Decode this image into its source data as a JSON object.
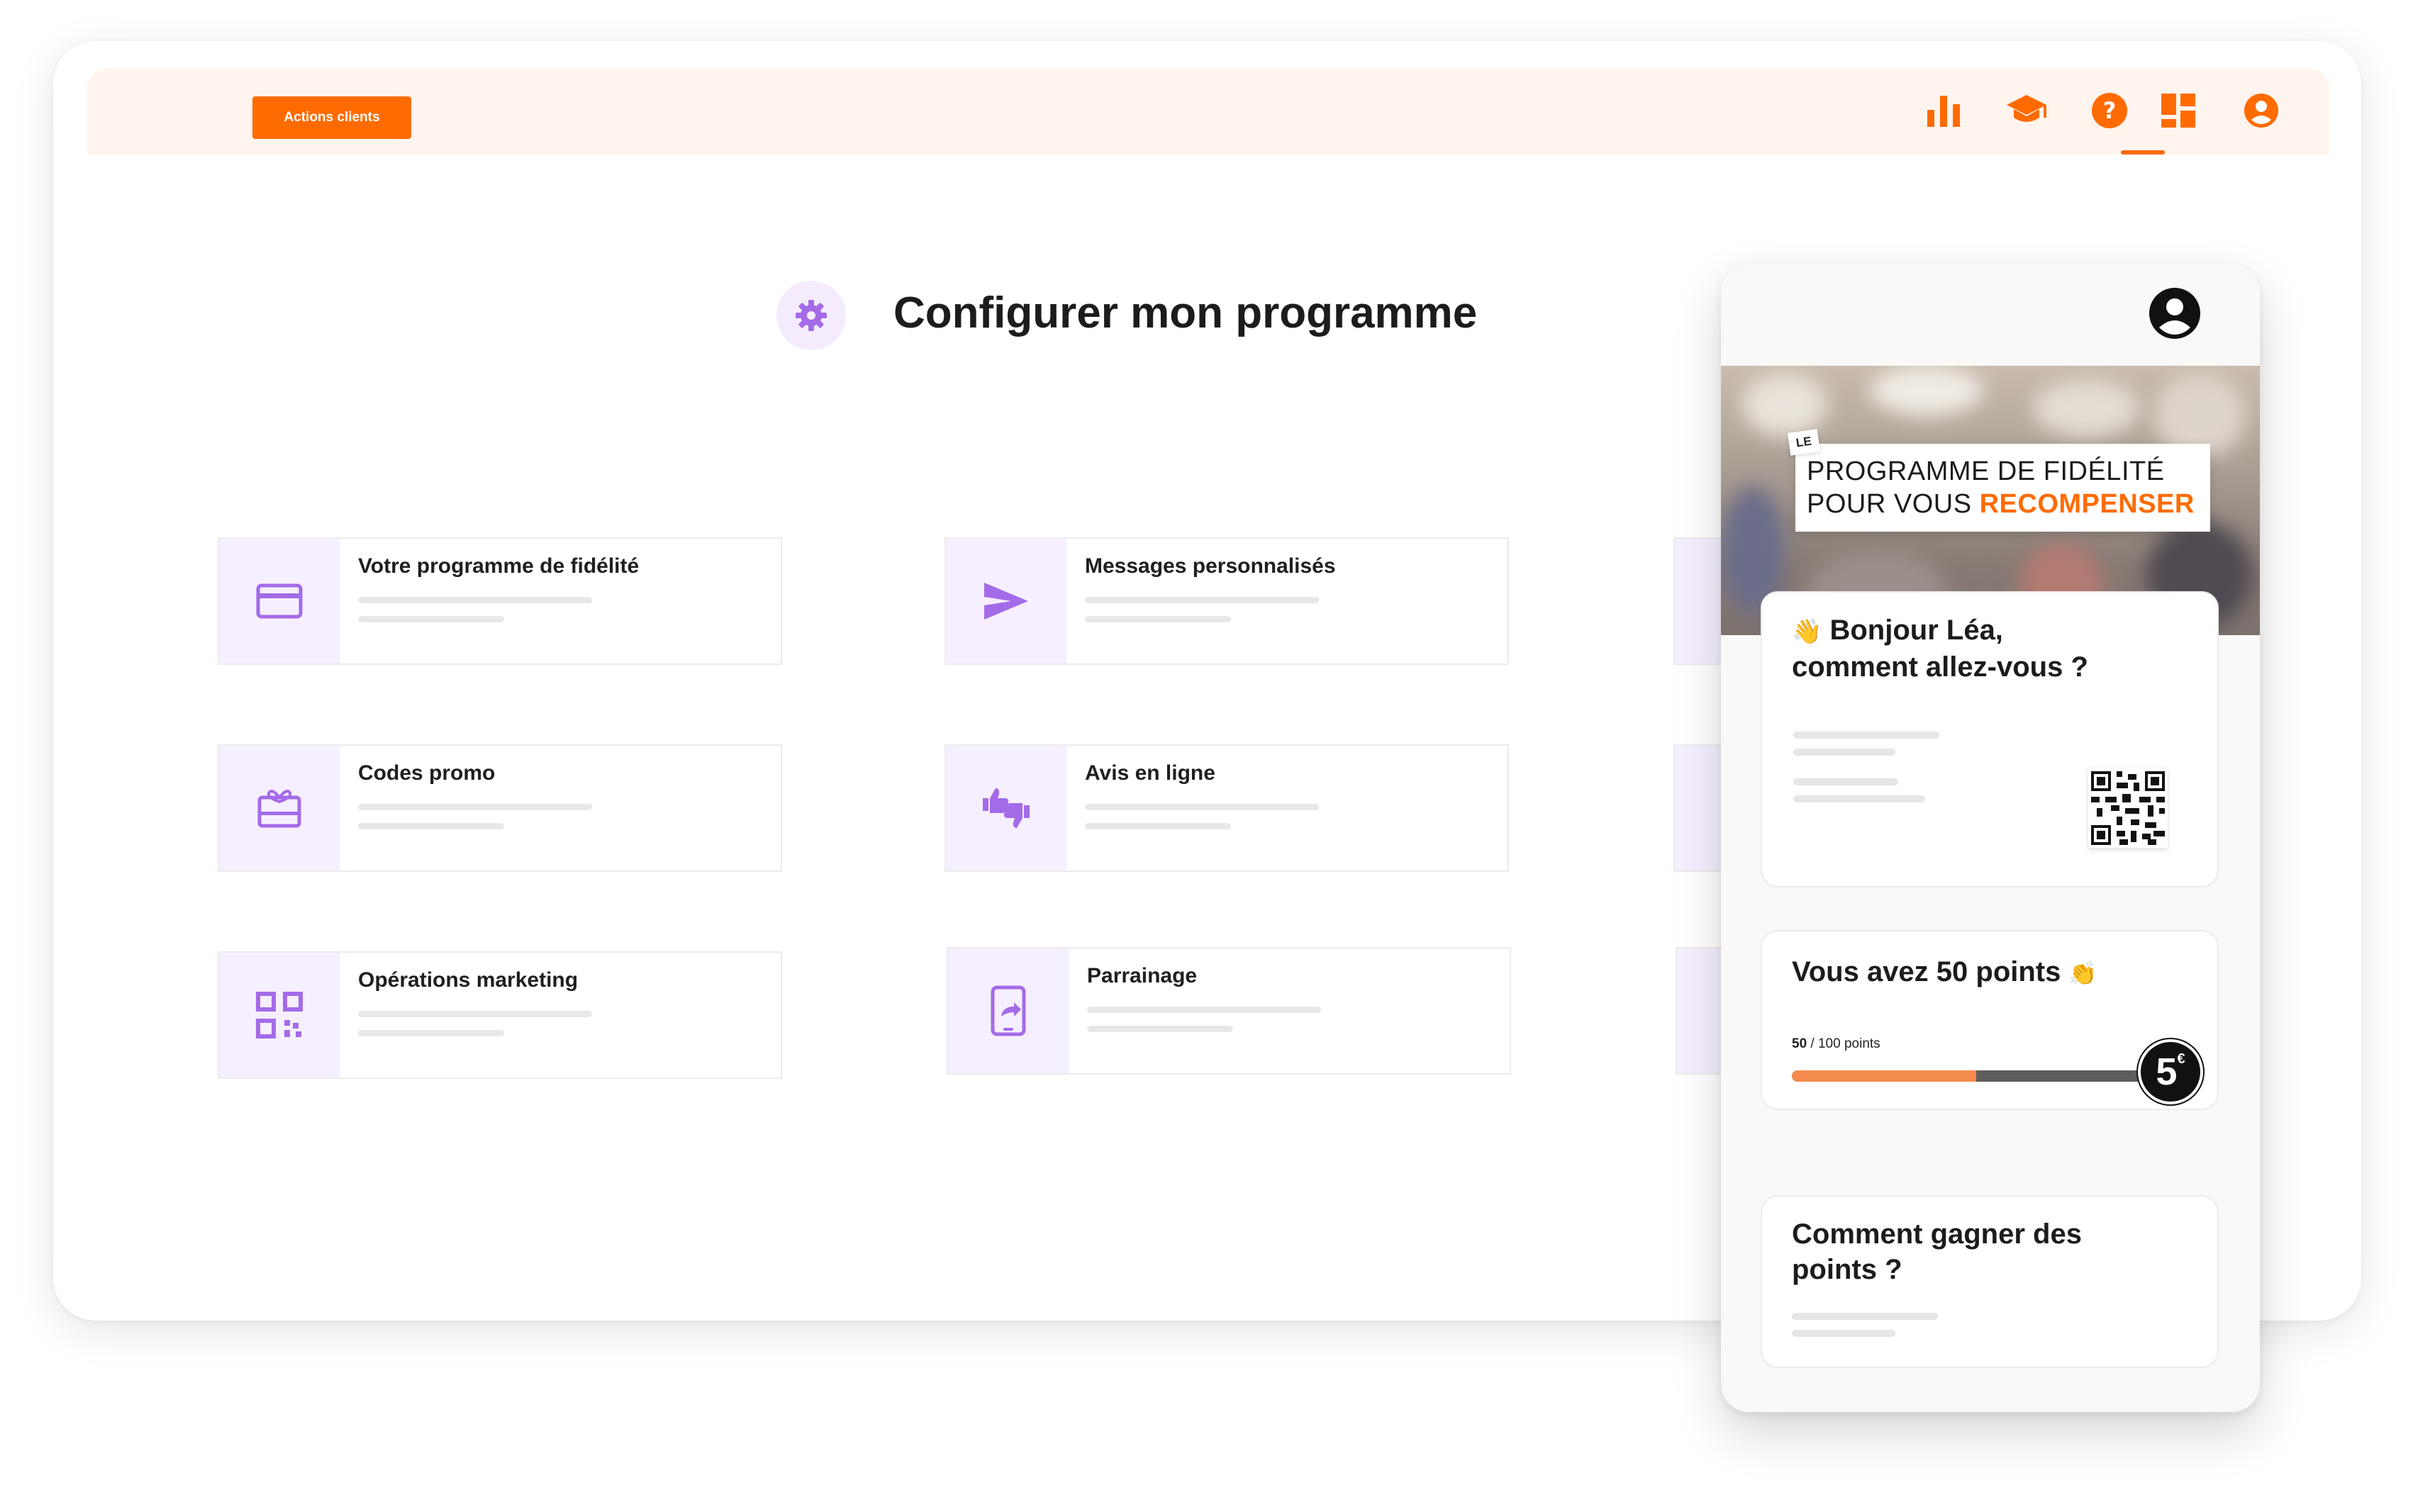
{
  "topbar": {
    "action_button": "Actions clients",
    "nav_icons": [
      "chart-bar-icon",
      "graduation-cap-icon",
      "help-icon",
      "dashboard-icon",
      "user-account-icon"
    ],
    "active_nav": "dashboard-icon"
  },
  "page": {
    "title": "Configurer mon programme"
  },
  "cards": [
    {
      "title": "Votre programme de fidélité",
      "icon": "credit-card-icon"
    },
    {
      "title": "Messages personnalisés",
      "icon": "send-icon"
    },
    {
      "title": "Codes promo",
      "icon": "gift-card-icon"
    },
    {
      "title": "Avis en ligne",
      "icon": "thumbs-up-down-icon"
    },
    {
      "title": "Opérations marketing",
      "icon": "qr-code-icon"
    },
    {
      "title": "Parrainage",
      "icon": "phone-share-icon"
    }
  ],
  "phone": {
    "hero": {
      "le": "LE",
      "line1": "PROGRAMME DE FIDÉLITÉ",
      "line2_prefix": "POUR VOUS",
      "line2_accent": "RECOMPENSER"
    },
    "greeting": {
      "emoji": "👋",
      "title": "Bonjour Léa,",
      "subtitle": "comment allez-vous ?"
    },
    "points": {
      "title": "Vous avez 50 points",
      "emoji": "👏",
      "current": "50",
      "separator": " / ",
      "max_label": "100 points",
      "progress": 0.5,
      "reward": "5",
      "reward_unit": "€"
    },
    "earn": {
      "title": "Comment gagner des points ?"
    }
  },
  "colors": {
    "accent": "#ff6b00",
    "purple": "#a46be8",
    "purple_bg": "#f6efff"
  }
}
